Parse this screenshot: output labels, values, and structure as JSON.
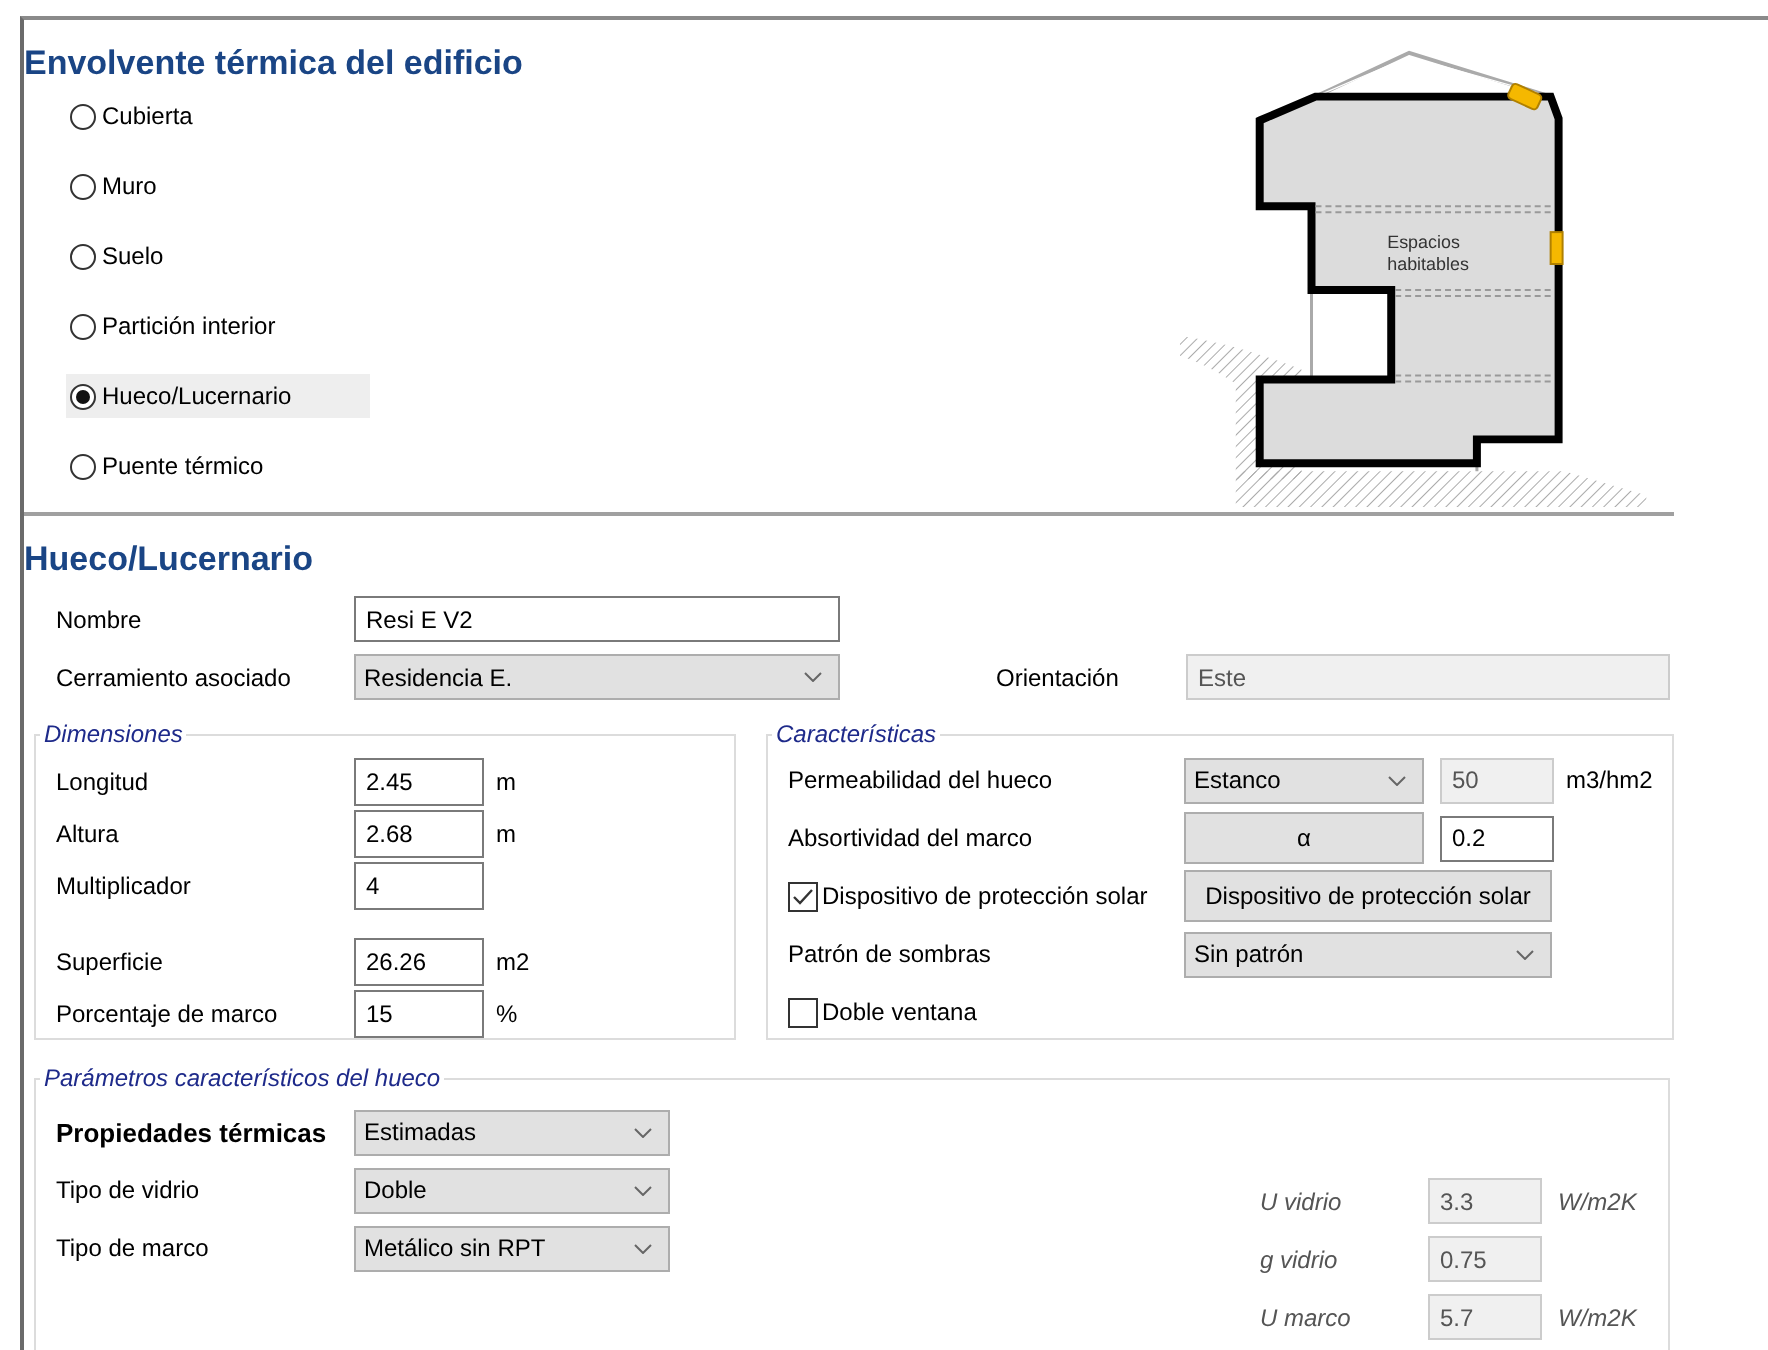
{
  "section_title": "Envolvente térmica del edificio",
  "element_types": [
    {
      "label": "Cubierta",
      "selected": false
    },
    {
      "label": "Muro",
      "selected": false
    },
    {
      "label": "Suelo",
      "selected": false
    },
    {
      "label": "Partición interior",
      "selected": false
    },
    {
      "label": "Hueco/Lucernario",
      "selected": true
    },
    {
      "label": "Puente térmico",
      "selected": false
    }
  ],
  "diagram_label": [
    "Espacios",
    "habitables"
  ],
  "form_title": "Hueco/Lucernario",
  "nombre": {
    "label": "Nombre",
    "value": "Resi E V2"
  },
  "cerramiento": {
    "label": "Cerramiento asociado",
    "value": "Residencia E."
  },
  "orientacion": {
    "label": "Orientación",
    "value": "Este",
    "disabled": true
  },
  "dimensiones": {
    "legend": "Dimensiones",
    "groups": [
      [
        {
          "label": "Longitud",
          "value": "2.45",
          "unit": "m"
        },
        {
          "label": "Altura",
          "value": "2.68",
          "unit": "m"
        },
        {
          "label": "Multiplicador",
          "value": "4"
        }
      ],
      [
        {
          "label": "Superficie",
          "value": "26.26",
          "unit": "m2"
        },
        {
          "label": "Porcentaje de marco",
          "value": "15",
          "unit": "%"
        }
      ]
    ]
  },
  "caracteristicas": {
    "legend": "Características",
    "permeabilidad": {
      "label": "Permeabilidad del hueco",
      "select": "Estanco",
      "value": "50",
      "unit": "m3/hm2"
    },
    "absortividad": {
      "label": "Absortividad del marco",
      "button": "α",
      "value": "0.2"
    },
    "proteccion": {
      "label": "Dispositivo de protección solar",
      "checked": true,
      "button": "Dispositivo de protección solar"
    },
    "sombras": {
      "label": "Patrón de sombras",
      "value": "Sin patrón"
    },
    "doble_ventana": {
      "label": "Doble ventana",
      "checked": false
    }
  },
  "parametros": {
    "legend": "Parámetros característicos del hueco",
    "selects": [
      {
        "label": "Propiedades térmicas",
        "value": "Estimadas",
        "bold": true
      },
      {
        "label": "Tipo de vidrio",
        "value": "Doble",
        "bold": false
      },
      {
        "label": "Tipo de marco",
        "value": "Metálico sin RPT",
        "bold": false
      }
    ],
    "outputs": [
      {
        "label": "U vidrio",
        "value": "3.3",
        "unit": "W/m2K"
      },
      {
        "label": "g vidrio",
        "value": "0.75"
      },
      {
        "label": "U marco",
        "value": "5.7",
        "unit": "W/m2K"
      }
    ]
  }
}
